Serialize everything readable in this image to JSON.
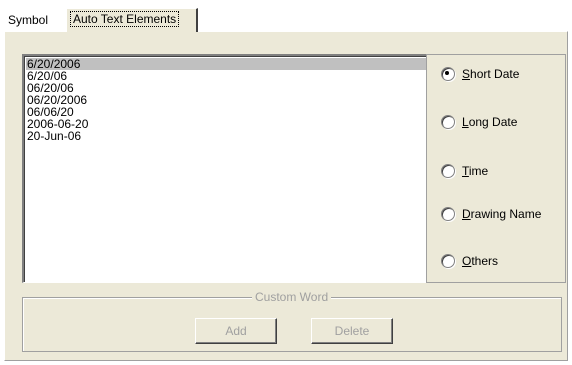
{
  "tabs": [
    {
      "label": "Symbol"
    },
    {
      "label": "Auto Text Elements"
    }
  ],
  "list": {
    "items": [
      "6/20/2006",
      "6/20/06",
      "06/20/06",
      "06/20/2006",
      "06/06/20",
      "2006-06-20",
      "20-Jun-06"
    ],
    "selected_index": 0
  },
  "options": [
    {
      "label": "Short Date",
      "mnemonic": "S",
      "rest": "hort Date",
      "checked": true
    },
    {
      "label": "Long Date",
      "mnemonic": "L",
      "rest": "ong Date",
      "checked": false
    },
    {
      "label": "Time",
      "mnemonic": "T",
      "rest": "ime",
      "checked": false
    },
    {
      "label": "Drawing Name",
      "mnemonic": "D",
      "rest": "rawing Name",
      "checked": false
    },
    {
      "label": "Others",
      "mnemonic": "O",
      "rest": "thers",
      "checked": false
    }
  ],
  "custom_word": {
    "title": "Custom Word",
    "add_label": "Add",
    "delete_label": "Delete"
  }
}
